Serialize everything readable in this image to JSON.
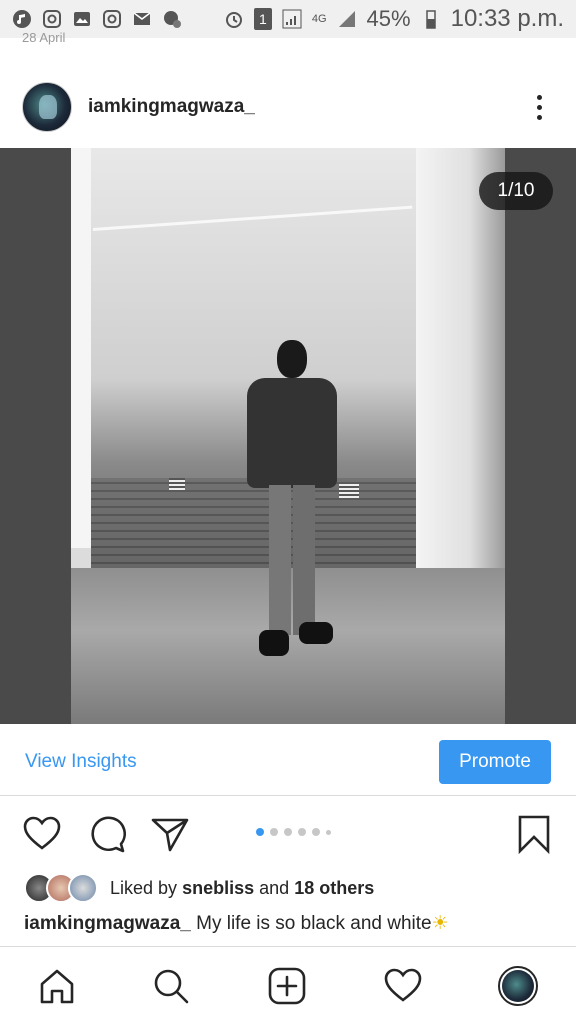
{
  "status_bar": {
    "battery": "45%",
    "time": "10:33 p.m.",
    "network": "4G",
    "sim": "1",
    "left_icons": [
      "music-icon",
      "instagram-icon",
      "gallery-icon",
      "instagram-icon",
      "mail-icon",
      "block-icon"
    ]
  },
  "post": {
    "date_partial": "28 April",
    "username": "iamkingmagwaza_",
    "counter": "1/10",
    "insights_label": "View Insights",
    "promote_label": "Promote",
    "likes_prefix": "Liked by",
    "likes_user": "snebliss",
    "likes_and": "and",
    "likes_others": "18 others",
    "caption_user": "iamkingmagwaza_",
    "caption_text": "My life is so black and white",
    "caption_emoji": "☀",
    "carousel_position": 1,
    "carousel_total": 10
  },
  "colors": {
    "accent": "#3897f0",
    "text": "#262626"
  }
}
